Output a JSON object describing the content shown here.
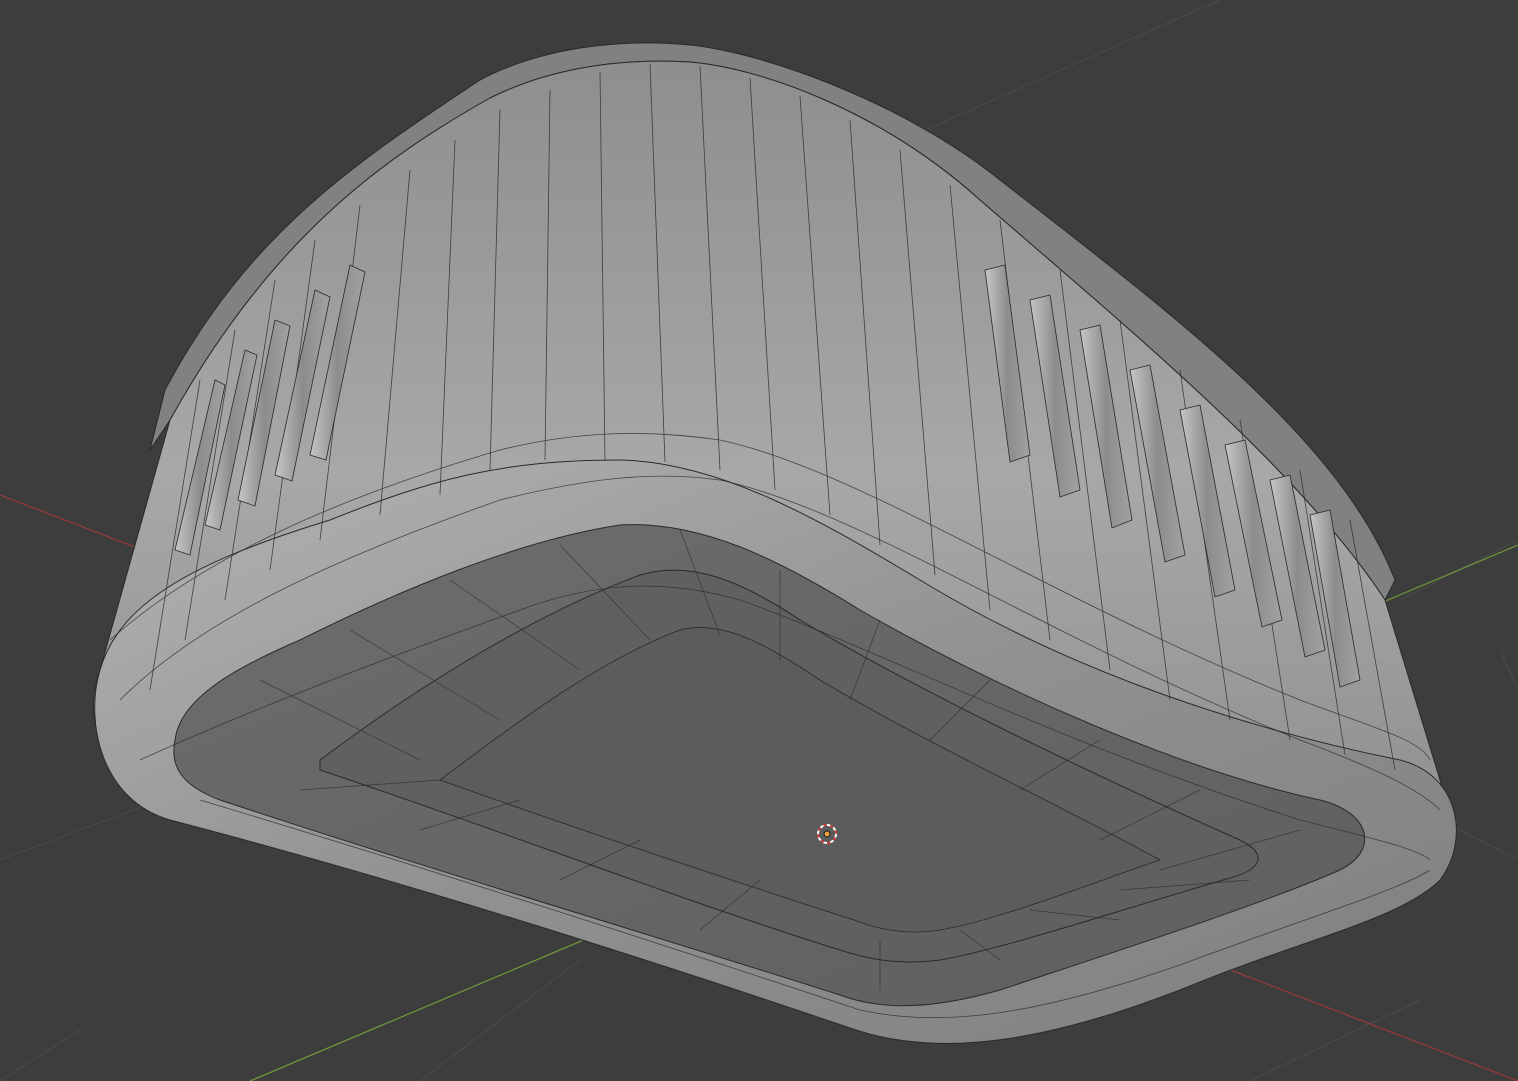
{
  "viewport": {
    "background": "#3d3d3d",
    "grid_color": "#4b4b4b",
    "x_axis_color": "#9a3a3a",
    "y_axis_color": "#6f9a3a",
    "mesh_color": "#9c9c9c",
    "wire_color": "#262626",
    "origin_color": "#e8a040",
    "cursor_ring_colors": [
      "#d83a3a",
      "#ffffff"
    ]
  },
  "scene": {
    "object": "rounded-box-mesh",
    "view": "bottom",
    "display": "wireframe-overlay",
    "icons": {
      "origin": "object-origin-icon",
      "cursor": "3d-cursor-icon"
    }
  }
}
